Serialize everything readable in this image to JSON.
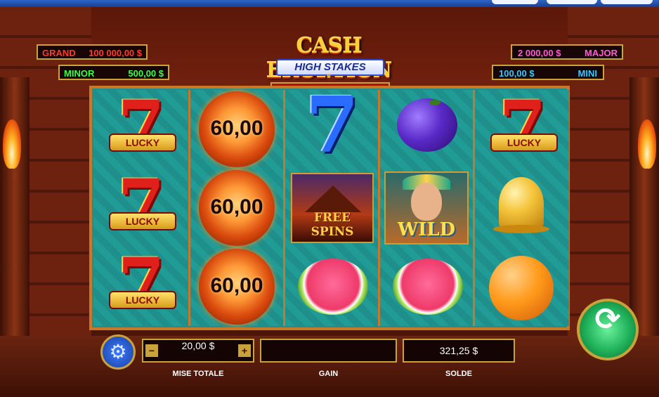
{
  "topbar": {
    "buttons": [
      "",
      "",
      ""
    ]
  },
  "jackpots": {
    "grand": {
      "label": "GRAND",
      "value": "100 000,00 $"
    },
    "minor": {
      "label": "MINOR",
      "value": "500,00 $"
    },
    "major": {
      "label": "MAJOR",
      "value": "2 000,00 $"
    },
    "mini": {
      "label": "MINI",
      "value": "100,00 $"
    }
  },
  "logo": {
    "title": "CASH ERUPTION",
    "subtitle": "HIGH STAKES"
  },
  "reels": {
    "lucky_text": "LUCKY",
    "fireball_value": "60,00",
    "free_spins_line1": "FREE",
    "free_spins_line2": "SPINS",
    "wild_text": "WILD",
    "symbols": [
      [
        "red-seven-lucky",
        "red-seven-lucky",
        "red-seven-lucky"
      ],
      [
        "fireball",
        "fireball",
        "fireball"
      ],
      [
        "blue-seven",
        "free-spins",
        "watermelon"
      ],
      [
        "plum",
        "wild",
        "watermelon"
      ],
      [
        "red-seven-lucky",
        "bell",
        "orange"
      ]
    ]
  },
  "controls": {
    "bet": {
      "label": "MISE TOTALE",
      "value": "20,00 $",
      "minus": "−",
      "plus": "+"
    },
    "win": {
      "label": "GAIN",
      "value": ""
    },
    "balance": {
      "label": "SOLDE",
      "value": "321,25 $"
    },
    "spin_icon": "refresh-arrow-icon",
    "settings_icon": "gear-icon"
  }
}
